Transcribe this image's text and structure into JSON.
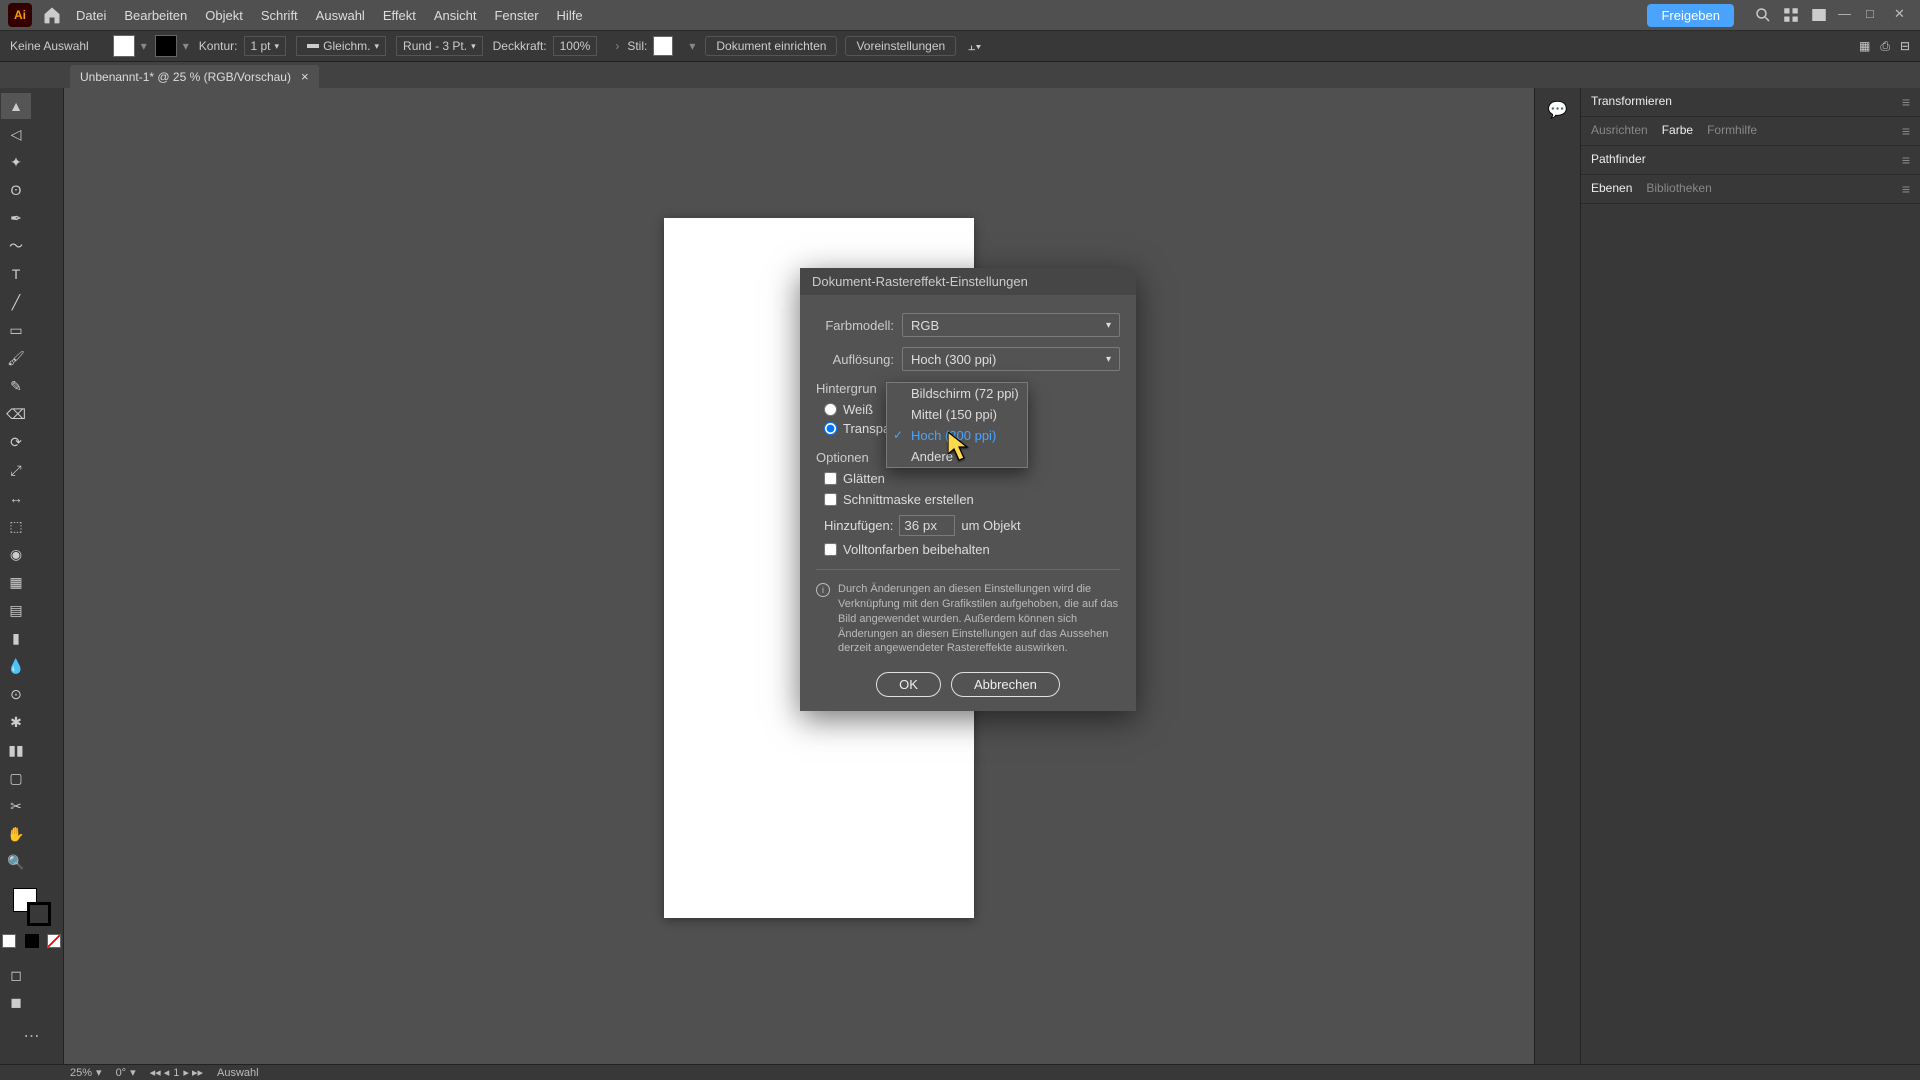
{
  "menubar": {
    "app_logo": "Ai",
    "items": [
      "Datei",
      "Bearbeiten",
      "Objekt",
      "Schrift",
      "Auswahl",
      "Effekt",
      "Ansicht",
      "Fenster",
      "Hilfe"
    ],
    "share": "Freigeben"
  },
  "controlbar": {
    "noselection": "Keine Auswahl",
    "kontur": "Kontur:",
    "kontur_val": "1 pt",
    "stroke_style": "Gleichm.",
    "profile": "Rund - 3 Pt.",
    "deckkraft": "Deckkraft:",
    "deckkraft_val": "100%",
    "stil": "Stil:",
    "btn_doc": "Dokument einrichten",
    "btn_pref": "Voreinstellungen"
  },
  "doctab": {
    "label": "Unbenannt-1* @ 25 % (RGB/Vorschau)"
  },
  "rightpanels": {
    "row1": [
      "Transformieren"
    ],
    "row2": [
      "Ausrichten",
      "Farbe",
      "Formhilfe"
    ],
    "row3": [
      "Pathfinder"
    ],
    "row4": [
      "Ebenen",
      "Bibliotheken"
    ]
  },
  "dialog": {
    "title": "Dokument-Rastereffekt-Einstellungen",
    "farbmodell_lbl": "Farbmodell:",
    "farbmodell_val": "RGB",
    "aufloesung_lbl": "Auflösung:",
    "aufloesung_val": "Hoch (300 ppi)",
    "hintergrund_lbl": "Hintergrun",
    "radio_weiss": "Weiß",
    "radio_transp": "Transpa",
    "optionen_lbl": "Optionen",
    "chk_glaetten": "Glätten",
    "chk_schnittmaske": "Schnittmaske erstellen",
    "hinzu_lbl": "Hinzufügen:",
    "hinzu_val": "36 px",
    "hinzu_suffix": "um Objekt",
    "chk_volltonfarben": "Volltonfarben beibehalten",
    "info": "Durch Änderungen an diesen Einstellungen wird die Verknüpfung mit den Grafikstilen aufgehoben, die auf das Bild angewendet wurden. Außerdem können sich Änderungen an diesen Einstellungen auf das Aussehen derzeit angewendeter Rastereffekte auswirken.",
    "ok": "OK",
    "cancel": "Abbrechen"
  },
  "dropdown": {
    "opts": [
      "Bildschirm (72 ppi)",
      "Mittel (150 ppi)",
      "Hoch (300 ppi)",
      "Andere"
    ],
    "selected_index": 2
  },
  "statusbar": {
    "zoom": "25%",
    "rotate": "0°",
    "art": "1",
    "tool": "Auswahl"
  }
}
